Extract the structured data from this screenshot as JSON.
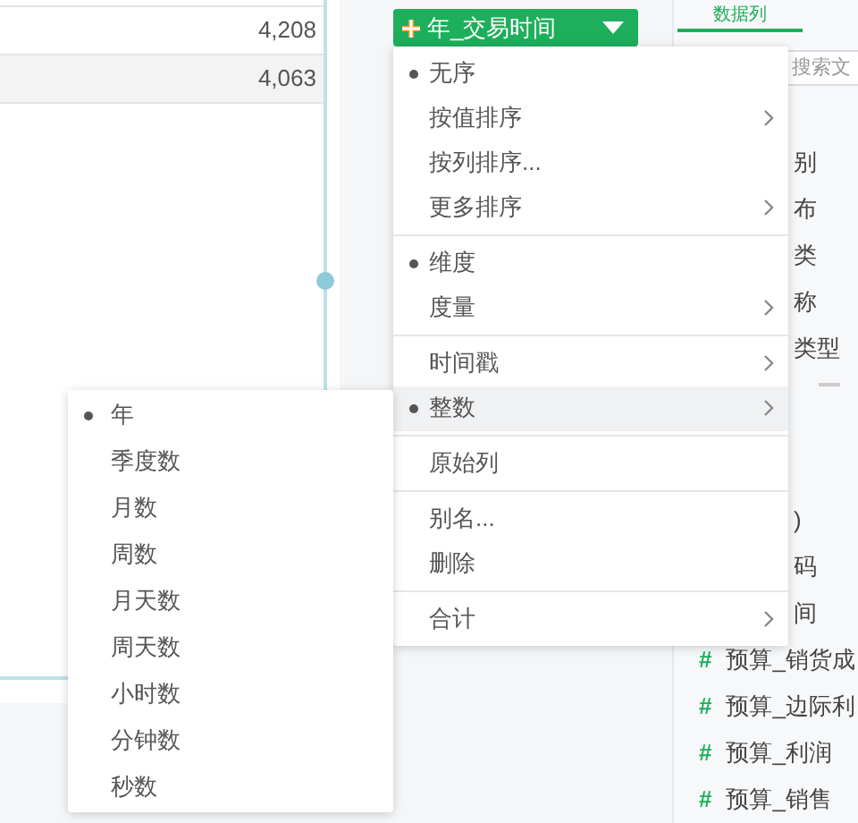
{
  "table": {
    "rows": [
      {
        "value": "4,208",
        "shaded": false
      },
      {
        "value": "4,063",
        "shaded": true
      }
    ]
  },
  "field_pill": {
    "label": "年_交易时间"
  },
  "context_menu": {
    "groups": [
      [
        {
          "label": "无序",
          "selected": true,
          "arrow": false,
          "highlighted": false
        },
        {
          "label": "按值排序",
          "selected": false,
          "arrow": true,
          "highlighted": false
        },
        {
          "label": "按列排序...",
          "selected": false,
          "arrow": false,
          "highlighted": false
        },
        {
          "label": "更多排序",
          "selected": false,
          "arrow": true,
          "highlighted": false
        }
      ],
      [
        {
          "label": "维度",
          "selected": true,
          "arrow": false,
          "highlighted": false
        },
        {
          "label": "度量",
          "selected": false,
          "arrow": true,
          "highlighted": false
        }
      ],
      [
        {
          "label": "时间戳",
          "selected": false,
          "arrow": true,
          "highlighted": false
        },
        {
          "label": "整数",
          "selected": true,
          "arrow": true,
          "highlighted": true
        }
      ],
      [
        {
          "label": "原始列",
          "selected": false,
          "arrow": false,
          "highlighted": false
        }
      ],
      [
        {
          "label": "别名...",
          "selected": false,
          "arrow": false,
          "highlighted": false
        },
        {
          "label": "删除",
          "selected": false,
          "arrow": false,
          "highlighted": false
        }
      ],
      [
        {
          "label": "合计",
          "selected": false,
          "arrow": true,
          "highlighted": false
        }
      ]
    ]
  },
  "submenu": {
    "items": [
      {
        "label": "年",
        "selected": true
      },
      {
        "label": "季度数",
        "selected": false
      },
      {
        "label": "月数",
        "selected": false
      },
      {
        "label": "周数",
        "selected": false
      },
      {
        "label": "月天数",
        "selected": false
      },
      {
        "label": "周天数",
        "selected": false
      },
      {
        "label": "小时数",
        "selected": false
      },
      {
        "label": "分钟数",
        "selected": false
      },
      {
        "label": "秒数",
        "selected": false
      }
    ]
  },
  "right_panel": {
    "tab": {
      "label": "数据列",
      "selected": true
    },
    "search": {
      "placeholder": "搜索文"
    },
    "fields_top": [
      {
        "kind": "partial",
        "label": "别"
      },
      {
        "kind": "partial",
        "label": "布"
      },
      {
        "kind": "partial",
        "label": "类"
      },
      {
        "kind": "partial",
        "label": "称"
      },
      {
        "kind": "partial",
        "label": "类型"
      }
    ],
    "fields_bottom": [
      {
        "kind": "partial",
        "label": ")"
      },
      {
        "kind": "partial",
        "label": "码"
      },
      {
        "kind": "partial",
        "label": "间"
      },
      {
        "kind": "measure",
        "icon": "#",
        "label": "预算_销货成"
      },
      {
        "kind": "measure",
        "icon": "#",
        "label": "预算_边际利"
      },
      {
        "kind": "measure",
        "icon": "#",
        "label": "预算_利润"
      },
      {
        "kind": "measure",
        "icon": "#",
        "label": "预算_销售"
      }
    ]
  }
}
